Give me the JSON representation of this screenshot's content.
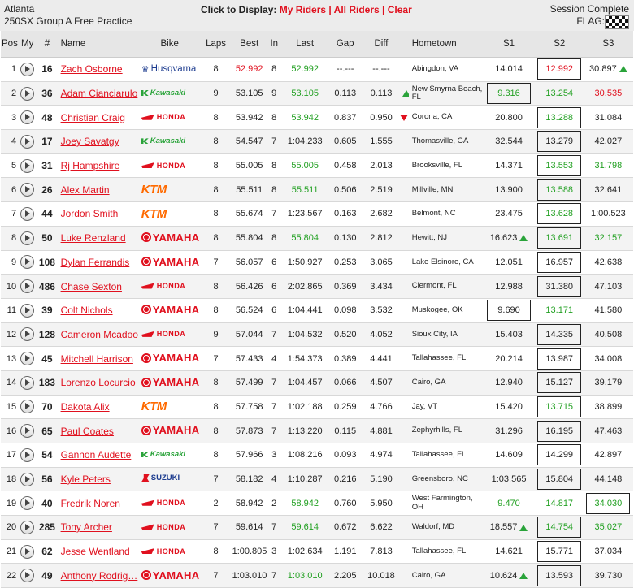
{
  "header": {
    "venue": "Atlanta",
    "session": "250SX Group A Free Practice",
    "click_label": "Click to Display:",
    "my_riders": "My Riders",
    "all_riders": "All Riders",
    "clear": "Clear",
    "separator": "|",
    "status": "Session Complete",
    "flag_label": "FLAG:"
  },
  "columns": [
    "Pos",
    "My",
    "#",
    "Name",
    "Bike",
    "Laps",
    "Best",
    "In",
    "Last",
    "Gap",
    "Diff",
    "Hometown",
    "S1",
    "S2",
    "S3"
  ],
  "rows": [
    {
      "pos": "1",
      "num": "16",
      "name": "Zach Osborne",
      "bike": "husqvarna",
      "bike_label": "Husqvarna",
      "laps": "8",
      "best": "52.992",
      "best_color": "red",
      "in": "8",
      "last": "52.992",
      "last_color": "green",
      "gap": "--.---",
      "diff": "--.---",
      "trend": "",
      "hometown": "Abingdon, VA",
      "s1": "14.014",
      "s1_color": "",
      "s1_box": false,
      "s1_arrow": "",
      "s2": "12.992",
      "s2_color": "red",
      "s2_box": true,
      "s2_arrow": "",
      "s3": "30.897",
      "s3_color": "",
      "s3_box": false,
      "s3_arrow": "up"
    },
    {
      "pos": "2",
      "num": "36",
      "name": "Adam Cianciarulo",
      "bike": "kawasaki",
      "bike_label": "Kawasaki",
      "laps": "9",
      "best": "53.105",
      "best_color": "",
      "in": "9",
      "last": "53.105",
      "last_color": "green",
      "gap": "0.113",
      "diff": "0.113",
      "trend": "up",
      "hometown": "New Smyrna Beach, FL",
      "s1": "9.316",
      "s1_color": "green",
      "s1_box": true,
      "s1_arrow": "",
      "s2": "13.254",
      "s2_color": "green",
      "s2_box": false,
      "s2_arrow": "",
      "s3": "30.535",
      "s3_color": "red",
      "s3_box": false,
      "s3_arrow": ""
    },
    {
      "pos": "3",
      "num": "48",
      "name": "Christian Craig",
      "bike": "honda",
      "bike_label": "HONDA",
      "laps": "8",
      "best": "53.942",
      "best_color": "",
      "in": "8",
      "last": "53.942",
      "last_color": "green",
      "gap": "0.837",
      "diff": "0.950",
      "trend": "down",
      "hometown": "Corona, CA",
      "s1": "20.800",
      "s1_color": "",
      "s1_box": false,
      "s1_arrow": "",
      "s2": "13.288",
      "s2_color": "green",
      "s2_box": true,
      "s2_arrow": "",
      "s3": "31.084",
      "s3_color": "",
      "s3_box": false,
      "s3_arrow": ""
    },
    {
      "pos": "4",
      "num": "17",
      "name": "Joey Savatgy",
      "bike": "kawasaki",
      "bike_label": "Kawasaki",
      "laps": "8",
      "best": "54.547",
      "best_color": "",
      "in": "7",
      "last": "1:04.233",
      "last_color": "",
      "gap": "0.605",
      "diff": "1.555",
      "trend": "",
      "hometown": "Thomasville, GA",
      "s1": "32.544",
      "s1_color": "",
      "s1_box": false,
      "s1_arrow": "",
      "s2": "13.279",
      "s2_color": "",
      "s2_box": true,
      "s2_arrow": "",
      "s3": "42.027",
      "s3_color": "",
      "s3_box": false,
      "s3_arrow": ""
    },
    {
      "pos": "5",
      "num": "31",
      "name": "Rj Hampshire",
      "bike": "honda",
      "bike_label": "HONDA",
      "laps": "8",
      "best": "55.005",
      "best_color": "",
      "in": "8",
      "last": "55.005",
      "last_color": "green",
      "gap": "0.458",
      "diff": "2.013",
      "trend": "",
      "hometown": "Brooksville, FL",
      "s1": "14.371",
      "s1_color": "",
      "s1_box": false,
      "s1_arrow": "",
      "s2": "13.553",
      "s2_color": "green",
      "s2_box": true,
      "s2_arrow": "",
      "s3": "31.798",
      "s3_color": "green",
      "s3_box": false,
      "s3_arrow": ""
    },
    {
      "pos": "6",
      "num": "26",
      "name": "Alex Martin",
      "bike": "ktm",
      "bike_label": "KTM",
      "laps": "8",
      "best": "55.511",
      "best_color": "",
      "in": "8",
      "last": "55.511",
      "last_color": "green",
      "gap": "0.506",
      "diff": "2.519",
      "trend": "",
      "hometown": "Millville, MN",
      "s1": "13.900",
      "s1_color": "",
      "s1_box": false,
      "s1_arrow": "",
      "s2": "13.588",
      "s2_color": "green",
      "s2_box": true,
      "s2_arrow": "",
      "s3": "32.641",
      "s3_color": "",
      "s3_box": false,
      "s3_arrow": ""
    },
    {
      "pos": "7",
      "num": "44",
      "name": "Jordon Smith",
      "bike": "ktm",
      "bike_label": "KTM",
      "laps": "8",
      "best": "55.674",
      "best_color": "",
      "in": "7",
      "last": "1:23.567",
      "last_color": "",
      "gap": "0.163",
      "diff": "2.682",
      "trend": "",
      "hometown": "Belmont, NC",
      "s1": "23.475",
      "s1_color": "",
      "s1_box": false,
      "s1_arrow": "",
      "s2": "13.628",
      "s2_color": "green",
      "s2_box": true,
      "s2_arrow": "",
      "s3": "1:00.523",
      "s3_color": "",
      "s3_box": false,
      "s3_arrow": ""
    },
    {
      "pos": "8",
      "num": "50",
      "name": "Luke Renzland",
      "bike": "yamaha",
      "bike_label": "YAMAHA",
      "laps": "8",
      "best": "55.804",
      "best_color": "",
      "in": "8",
      "last": "55.804",
      "last_color": "green",
      "gap": "0.130",
      "diff": "2.812",
      "trend": "",
      "hometown": "Hewitt, NJ",
      "s1": "16.623",
      "s1_color": "",
      "s1_box": false,
      "s1_arrow": "up",
      "s2": "13.691",
      "s2_color": "green",
      "s2_box": true,
      "s2_arrow": "",
      "s3": "32.157",
      "s3_color": "green",
      "s3_box": false,
      "s3_arrow": ""
    },
    {
      "pos": "9",
      "num": "108",
      "name": "Dylan Ferrandis",
      "bike": "yamaha",
      "bike_label": "YAMAHA",
      "laps": "7",
      "best": "56.057",
      "best_color": "",
      "in": "6",
      "last": "1:50.927",
      "last_color": "",
      "gap": "0.253",
      "diff": "3.065",
      "trend": "",
      "hometown": "Lake Elsinore, CA",
      "s1": "12.051",
      "s1_color": "",
      "s1_box": false,
      "s1_arrow": "",
      "s2": "16.957",
      "s2_color": "",
      "s2_box": true,
      "s2_arrow": "",
      "s3": "42.638",
      "s3_color": "",
      "s3_box": false,
      "s3_arrow": ""
    },
    {
      "pos": "10",
      "num": "486",
      "name": "Chase Sexton",
      "bike": "honda",
      "bike_label": "HONDA",
      "laps": "8",
      "best": "56.426",
      "best_color": "",
      "in": "6",
      "last": "2:02.865",
      "last_color": "",
      "gap": "0.369",
      "diff": "3.434",
      "trend": "",
      "hometown": "Clermont, FL",
      "s1": "12.988",
      "s1_color": "",
      "s1_box": false,
      "s1_arrow": "",
      "s2": "31.380",
      "s2_color": "",
      "s2_box": true,
      "s2_arrow": "",
      "s3": "47.103",
      "s3_color": "",
      "s3_box": false,
      "s3_arrow": ""
    },
    {
      "pos": "11",
      "num": "39",
      "name": "Colt Nichols",
      "bike": "yamaha",
      "bike_label": "YAMAHA",
      "laps": "8",
      "best": "56.524",
      "best_color": "",
      "in": "6",
      "last": "1:04.441",
      "last_color": "",
      "gap": "0.098",
      "diff": "3.532",
      "trend": "",
      "hometown": "Muskogee, OK",
      "s1": "9.690",
      "s1_color": "",
      "s1_box": true,
      "s1_arrow": "",
      "s2": "13.171",
      "s2_color": "green",
      "s2_box": false,
      "s2_arrow": "",
      "s3": "41.580",
      "s3_color": "",
      "s3_box": false,
      "s3_arrow": ""
    },
    {
      "pos": "12",
      "num": "128",
      "name": "Cameron Mcadoo",
      "bike": "honda",
      "bike_label": "HONDA",
      "laps": "9",
      "best": "57.044",
      "best_color": "",
      "in": "7",
      "last": "1:04.532",
      "last_color": "",
      "gap": "0.520",
      "diff": "4.052",
      "trend": "",
      "hometown": "Sioux City, IA",
      "s1": "15.403",
      "s1_color": "",
      "s1_box": false,
      "s1_arrow": "",
      "s2": "14.335",
      "s2_color": "",
      "s2_box": true,
      "s2_arrow": "",
      "s3": "40.508",
      "s3_color": "",
      "s3_box": false,
      "s3_arrow": ""
    },
    {
      "pos": "13",
      "num": "45",
      "name": "Mitchell Harrison",
      "bike": "yamaha",
      "bike_label": "YAMAHA",
      "laps": "7",
      "best": "57.433",
      "best_color": "",
      "in": "4",
      "last": "1:54.373",
      "last_color": "",
      "gap": "0.389",
      "diff": "4.441",
      "trend": "",
      "hometown": "Tallahassee, FL",
      "s1": "20.214",
      "s1_color": "",
      "s1_box": false,
      "s1_arrow": "",
      "s2": "13.987",
      "s2_color": "",
      "s2_box": true,
      "s2_arrow": "",
      "s3": "34.008",
      "s3_color": "",
      "s3_box": false,
      "s3_arrow": ""
    },
    {
      "pos": "14",
      "num": "183",
      "name": "Lorenzo Locurcio",
      "bike": "yamaha",
      "bike_label": "YAMAHA",
      "laps": "8",
      "best": "57.499",
      "best_color": "",
      "in": "7",
      "last": "1:04.457",
      "last_color": "",
      "gap": "0.066",
      "diff": "4.507",
      "trend": "",
      "hometown": "Cairo, GA",
      "s1": "12.940",
      "s1_color": "",
      "s1_box": false,
      "s1_arrow": "",
      "s2": "15.127",
      "s2_color": "",
      "s2_box": true,
      "s2_arrow": "",
      "s3": "39.179",
      "s3_color": "",
      "s3_box": false,
      "s3_arrow": ""
    },
    {
      "pos": "15",
      "num": "70",
      "name": "Dakota Alix",
      "bike": "ktm",
      "bike_label": "KTM",
      "laps": "8",
      "best": "57.758",
      "best_color": "",
      "in": "7",
      "last": "1:02.188",
      "last_color": "",
      "gap": "0.259",
      "diff": "4.766",
      "trend": "",
      "hometown": "Jay, VT",
      "s1": "15.420",
      "s1_color": "",
      "s1_box": false,
      "s1_arrow": "",
      "s2": "13.715",
      "s2_color": "green",
      "s2_box": true,
      "s2_arrow": "",
      "s3": "38.899",
      "s3_color": "",
      "s3_box": false,
      "s3_arrow": ""
    },
    {
      "pos": "16",
      "num": "65",
      "name": "Paul Coates",
      "bike": "yamaha",
      "bike_label": "YAMAHA",
      "laps": "8",
      "best": "57.873",
      "best_color": "",
      "in": "7",
      "last": "1:13.220",
      "last_color": "",
      "gap": "0.115",
      "diff": "4.881",
      "trend": "",
      "hometown": "Zephyrhills, FL",
      "s1": "31.296",
      "s1_color": "",
      "s1_box": false,
      "s1_arrow": "",
      "s2": "16.195",
      "s2_color": "",
      "s2_box": true,
      "s2_arrow": "",
      "s3": "47.463",
      "s3_color": "",
      "s3_box": false,
      "s3_arrow": ""
    },
    {
      "pos": "17",
      "num": "54",
      "name": "Gannon Audette",
      "bike": "kawasaki",
      "bike_label": "Kawasaki",
      "laps": "8",
      "best": "57.966",
      "best_color": "",
      "in": "3",
      "last": "1:08.216",
      "last_color": "",
      "gap": "0.093",
      "diff": "4.974",
      "trend": "",
      "hometown": "Tallahassee, FL",
      "s1": "14.609",
      "s1_color": "",
      "s1_box": false,
      "s1_arrow": "",
      "s2": "14.299",
      "s2_color": "",
      "s2_box": true,
      "s2_arrow": "",
      "s3": "42.897",
      "s3_color": "",
      "s3_box": false,
      "s3_arrow": ""
    },
    {
      "pos": "18",
      "num": "56",
      "name": "Kyle Peters",
      "bike": "suzuki",
      "bike_label": "SUZUKI",
      "laps": "7",
      "best": "58.182",
      "best_color": "",
      "in": "4",
      "last": "1:10.287",
      "last_color": "",
      "gap": "0.216",
      "diff": "5.190",
      "trend": "",
      "hometown": "Greensboro, NC",
      "s1": "1:03.565",
      "s1_color": "",
      "s1_box": false,
      "s1_arrow": "",
      "s2": "15.804",
      "s2_color": "",
      "s2_box": true,
      "s2_arrow": "",
      "s3": "44.148",
      "s3_color": "",
      "s3_box": false,
      "s3_arrow": ""
    },
    {
      "pos": "19",
      "num": "40",
      "name": "Fredrik Noren",
      "bike": "honda",
      "bike_label": "HONDA",
      "laps": "2",
      "best": "58.942",
      "best_color": "",
      "in": "2",
      "last": "58.942",
      "last_color": "green",
      "gap": "0.760",
      "diff": "5.950",
      "trend": "",
      "hometown": "West Farmington, OH",
      "s1": "9.470",
      "s1_color": "green",
      "s1_box": false,
      "s1_arrow": "",
      "s2": "14.817",
      "s2_color": "green",
      "s2_box": false,
      "s2_arrow": "",
      "s3": "34.030",
      "s3_color": "green",
      "s3_box": true,
      "s3_arrow": ""
    },
    {
      "pos": "20",
      "num": "285",
      "name": "Tony Archer",
      "bike": "honda",
      "bike_label": "HONDA",
      "laps": "7",
      "best": "59.614",
      "best_color": "",
      "in": "7",
      "last": "59.614",
      "last_color": "green",
      "gap": "0.672",
      "diff": "6.622",
      "trend": "",
      "hometown": "Waldorf, MD",
      "s1": "18.557",
      "s1_color": "",
      "s1_box": false,
      "s1_arrow": "up",
      "s2": "14.754",
      "s2_color": "green",
      "s2_box": true,
      "s2_arrow": "",
      "s3": "35.027",
      "s3_color": "green",
      "s3_box": false,
      "s3_arrow": ""
    },
    {
      "pos": "21",
      "num": "62",
      "name": "Jesse Wentland",
      "bike": "honda",
      "bike_label": "HONDA",
      "laps": "8",
      "best": "1:00.805",
      "best_color": "",
      "in": "3",
      "last": "1:02.634",
      "last_color": "",
      "gap": "1.191",
      "diff": "7.813",
      "trend": "",
      "hometown": "Tallahassee, FL",
      "s1": "14.621",
      "s1_color": "",
      "s1_box": false,
      "s1_arrow": "",
      "s2": "15.771",
      "s2_color": "",
      "s2_box": true,
      "s2_arrow": "",
      "s3": "37.034",
      "s3_color": "",
      "s3_box": false,
      "s3_arrow": ""
    },
    {
      "pos": "22",
      "num": "49",
      "name": "Anthony Rodrig…",
      "bike": "yamaha",
      "bike_label": "YAMAHA",
      "laps": "7",
      "best": "1:03.010",
      "best_color": "",
      "in": "7",
      "last": "1:03.010",
      "last_color": "green",
      "gap": "2.205",
      "diff": "10.018",
      "trend": "",
      "hometown": "Cairo, GA",
      "s1": "10.624",
      "s1_color": "",
      "s1_box": false,
      "s1_arrow": "up",
      "s2": "13.593",
      "s2_color": "",
      "s2_box": true,
      "s2_arrow": "",
      "s3": "39.730",
      "s3_color": "",
      "s3_box": false,
      "s3_arrow": ""
    }
  ],
  "colors": {
    "accent_red": "#e0101e",
    "accent_green": "#22a022",
    "header_bg": "#ececec"
  }
}
